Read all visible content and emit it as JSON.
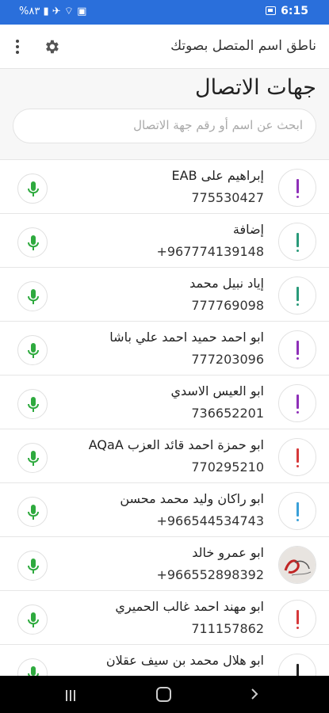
{
  "status_bar": {
    "left_text": "%٨٣ ▮ ✈ ⌔ ▣",
    "time": "6:15"
  },
  "app_bar": {
    "title": "ناطق اسم المتصل بصوتك"
  },
  "page": {
    "title": "جهات الاتصال",
    "search_placeholder": "ابحث عن اسم أو رقم جهة الاتصال"
  },
  "contacts": [
    {
      "name": "إبراهيم على EAB",
      "number": "775530427",
      "color": "#8e2fb8"
    },
    {
      "name": "إضافة",
      "number": "+967774139148",
      "color": "#2a9a7a"
    },
    {
      "name": "إياد نبيل محمد",
      "number": "777769098",
      "color": "#2a9a7a"
    },
    {
      "name": "ابو احمد حميد احمد علي باشا",
      "number": "777203096",
      "color": "#8e2fb8"
    },
    {
      "name": "ابو العيس الاسدي",
      "number": "736652201",
      "color": "#8e2fb8"
    },
    {
      "name": "ابو حمزة احمد قائد العزب AQaA",
      "number": "770295210",
      "color": "#d6393a"
    },
    {
      "name": "ابو راكان وليد محمد محسن",
      "number": "+966544534743",
      "color": "#3aa0d8"
    },
    {
      "name": "ابو عمرو خالد",
      "number": "+966552898392",
      "color": "photo"
    },
    {
      "name": "ابو مهند احمد غالب الحميري",
      "number": "711157862",
      "color": "#d6393a"
    },
    {
      "name": "ابو هلال محمد بن سيف عقلان",
      "number": "",
      "color": "#222222"
    }
  ],
  "colors": {
    "status_bar": "#2a6fdb",
    "mic_green": "#2eaa3e"
  }
}
